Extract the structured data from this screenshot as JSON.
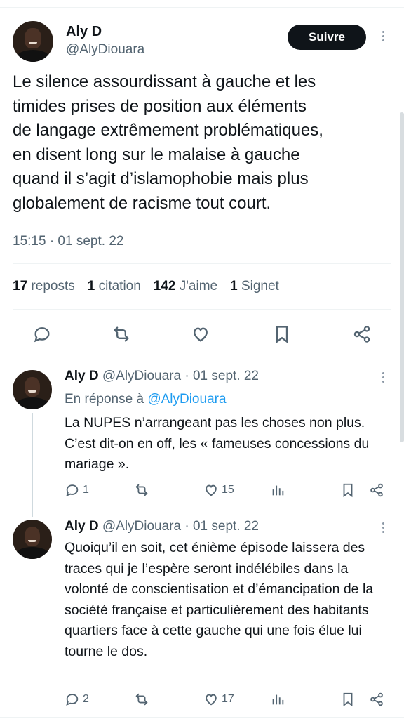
{
  "tweet": {
    "author_name": "Aly D",
    "author_handle": "@AlyDiouara",
    "follow_label": "Suivre",
    "text": "Le silence assourdissant à gauche et les\ntimides prises de position aux éléments\nde langage extrêmement problématiques,\nen disent long sur le malaise à gauche\nquand il s’agit d’islamophobie mais plus\nglobalement de racisme tout court.",
    "time": "15:15 · 01 sept. 22",
    "stats": {
      "reposts_count": "17",
      "reposts_label": "reposts",
      "quotes_count": "1",
      "quotes_label": "citation",
      "likes_count": "142",
      "likes_label": "J'aime",
      "bookmarks_count": "1",
      "bookmarks_label": "Signet"
    }
  },
  "replies": [
    {
      "author_name": "Aly D",
      "meta": "@AlyDiouara · 01 sept. 22",
      "reply_to_prefix": "En réponse à",
      "reply_to_handle": "@AlyDiouara",
      "text": "La NUPES n’arrangeant pas les choses non plus. C’est dit-on en off, les « fameuses concessions du mariage ».",
      "replies_count": "1",
      "likes_count": "15"
    },
    {
      "author_name": "Aly D",
      "meta": "@AlyDiouara · 01 sept. 22",
      "text": "Quoiqu’il en soit, cet énième épisode laissera des traces qui je l’espère seront indélébiles dans la volonté de conscientisation et d’émancipation de la société française et particulièrement des habitants quartiers face à cette gauche qui une fois élue lui tourne le dos.",
      "replies_count": "2",
      "likes_count": "17"
    }
  ],
  "icons": {
    "reply": "reply-icon",
    "repost": "repost-icon",
    "like": "heart-icon",
    "views": "views-icon",
    "bookmark": "bookmark-icon",
    "share": "share-icon",
    "more": "more-icon"
  },
  "colors": {
    "text": "#0f1419",
    "muted": "#536471",
    "link": "#1d9bf0",
    "button": "#0f1419"
  }
}
